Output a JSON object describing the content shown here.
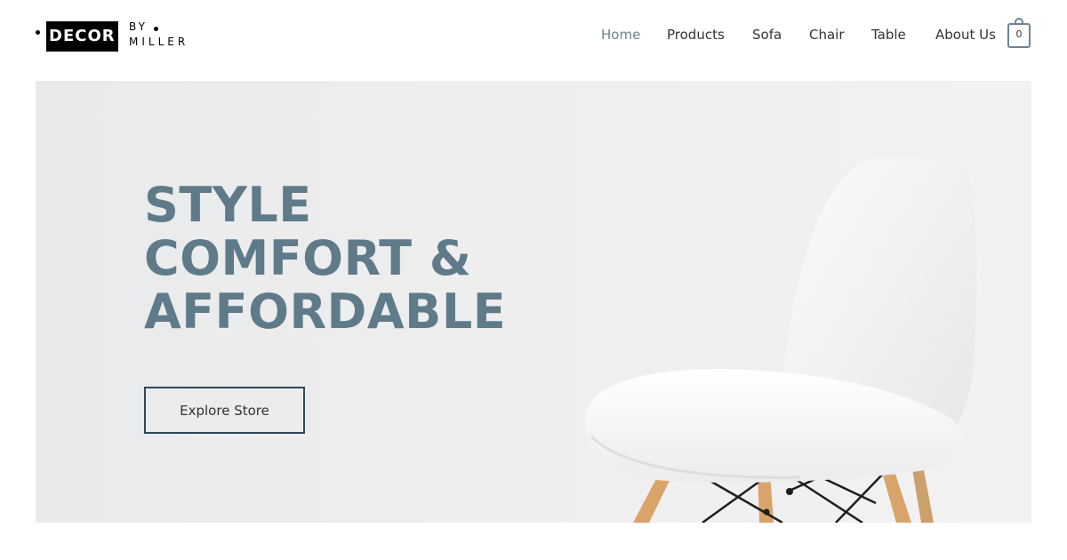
{
  "brand": {
    "logo_box": "DECOR",
    "logo_by": "BY",
    "logo_name": "MILLER"
  },
  "nav": {
    "items": [
      {
        "label": "Home",
        "active": true
      },
      {
        "label": "Products",
        "active": false
      },
      {
        "label": "Sofa",
        "active": false
      },
      {
        "label": "Chair",
        "active": false
      },
      {
        "label": "Table",
        "active": false
      },
      {
        "label": "About Us",
        "active": false
      }
    ],
    "cart_count": "0",
    "cart_icon": "shopping-bag-icon"
  },
  "hero": {
    "headline": [
      "STYLE",
      "COMFORT &",
      "AFFORDABLE"
    ],
    "cta_label": "Explore Store",
    "image": "white-chair-photo"
  },
  "colors": {
    "accent": "#6a8494",
    "headline": "#5f7a89",
    "cta_border": "#2e4657",
    "hero_bg": "#eeeeef"
  }
}
